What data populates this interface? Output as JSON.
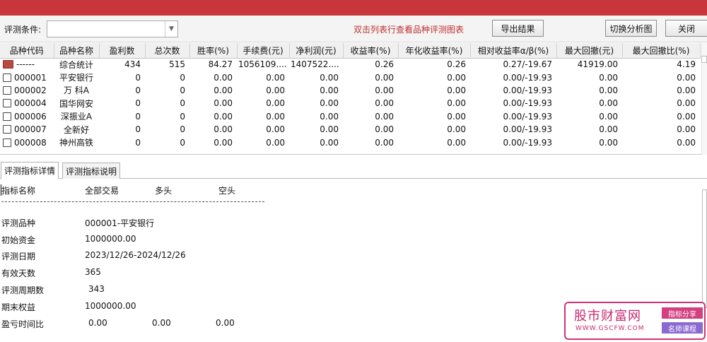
{
  "toolbar": {
    "condition_label": "评测条件:",
    "condition_value": "",
    "hint": "双击列表行查看品种评测图表",
    "export_label": "导出结果",
    "switch_label": "切换分析图",
    "close_label": "关闭"
  },
  "grid": {
    "columns": [
      "品种代码",
      "品种名称",
      "盈利数",
      "总次数",
      "胜率(%)",
      "手续费(元)",
      "净利润(元)",
      "收益率(%)",
      "年化收益率(%)",
      "相对收益率α/β(%)",
      "最大回撤(元)",
      "最大回撤比(%)"
    ],
    "rows": [
      {
        "icon": "folder-icon",
        "code": "------",
        "name": "综合统计",
        "win": "434",
        "total": "515",
        "rate": "84.27",
        "fee": "1056109....",
        "profit": "1407522....",
        "ret": "0.26",
        "annual": "0.26",
        "rel": "0.27/-19.67",
        "dd": "41919.00",
        "ddr": "4.19"
      },
      {
        "icon": "document-icon",
        "code": "000001",
        "name": "平安银行",
        "win": "0",
        "total": "0",
        "rate": "0.00",
        "fee": "0.00",
        "profit": "0.00",
        "ret": "0.00",
        "annual": "0.00",
        "rel": "0.00/-19.93",
        "dd": "0.00",
        "ddr": "0.00"
      },
      {
        "icon": "document-icon",
        "code": "000002",
        "name": "万 科A",
        "win": "0",
        "total": "0",
        "rate": "0.00",
        "fee": "0.00",
        "profit": "0.00",
        "ret": "0.00",
        "annual": "0.00",
        "rel": "0.00/-19.93",
        "dd": "0.00",
        "ddr": "0.00"
      },
      {
        "icon": "document-icon",
        "code": "000004",
        "name": "国华网安",
        "win": "0",
        "total": "0",
        "rate": "0.00",
        "fee": "0.00",
        "profit": "0.00",
        "ret": "0.00",
        "annual": "0.00",
        "rel": "0.00/-19.93",
        "dd": "0.00",
        "ddr": "0.00"
      },
      {
        "icon": "document-icon",
        "code": "000006",
        "name": "深振业A",
        "win": "0",
        "total": "0",
        "rate": "0.00",
        "fee": "0.00",
        "profit": "0.00",
        "ret": "0.00",
        "annual": "0.00",
        "rel": "0.00/-19.93",
        "dd": "0.00",
        "ddr": "0.00"
      },
      {
        "icon": "document-icon",
        "code": "000007",
        "name": "全新好",
        "win": "0",
        "total": "0",
        "rate": "0.00",
        "fee": "0.00",
        "profit": "0.00",
        "ret": "0.00",
        "annual": "0.00",
        "rel": "0.00/-19.93",
        "dd": "0.00",
        "ddr": "0.00"
      },
      {
        "icon": "document-icon",
        "code": "000008",
        "name": "神州高铁",
        "win": "0",
        "total": "0",
        "rate": "0.00",
        "fee": "0.00",
        "profit": "0.00",
        "ret": "0.00",
        "annual": "0.00",
        "rel": "0.00/-19.93",
        "dd": "0.00",
        "ddr": "0.00"
      }
    ]
  },
  "tabs": [
    {
      "label": "评测指标详情",
      "active": true
    },
    {
      "label": "评测指标说明",
      "active": false
    }
  ],
  "details": {
    "header": [
      "指标名称",
      "全部交易",
      "多头",
      "空头"
    ],
    "rows": [
      {
        "label": "评测品种",
        "values": [
          "000001-平安银行"
        ]
      },
      {
        "label": "初始资金",
        "values": [
          "1000000.00"
        ]
      },
      {
        "label": "评测日期",
        "values": [
          "2023/12/26-2024/12/26"
        ]
      },
      {
        "label": "有效天数",
        "values": [
          "365"
        ]
      },
      {
        "label": "评测周期数",
        "values": [
          "343"
        ]
      },
      {
        "label": "期末权益",
        "values": [
          "1000000.00"
        ]
      },
      {
        "label": "盈亏时间比",
        "values": [
          "0.00",
          "0.00",
          "0.00"
        ]
      }
    ]
  },
  "watermark": {
    "title": "股市财富网",
    "url": "WWW.GSCFW.COM",
    "tag1": "指标分享",
    "tag2": "名师课程"
  }
}
